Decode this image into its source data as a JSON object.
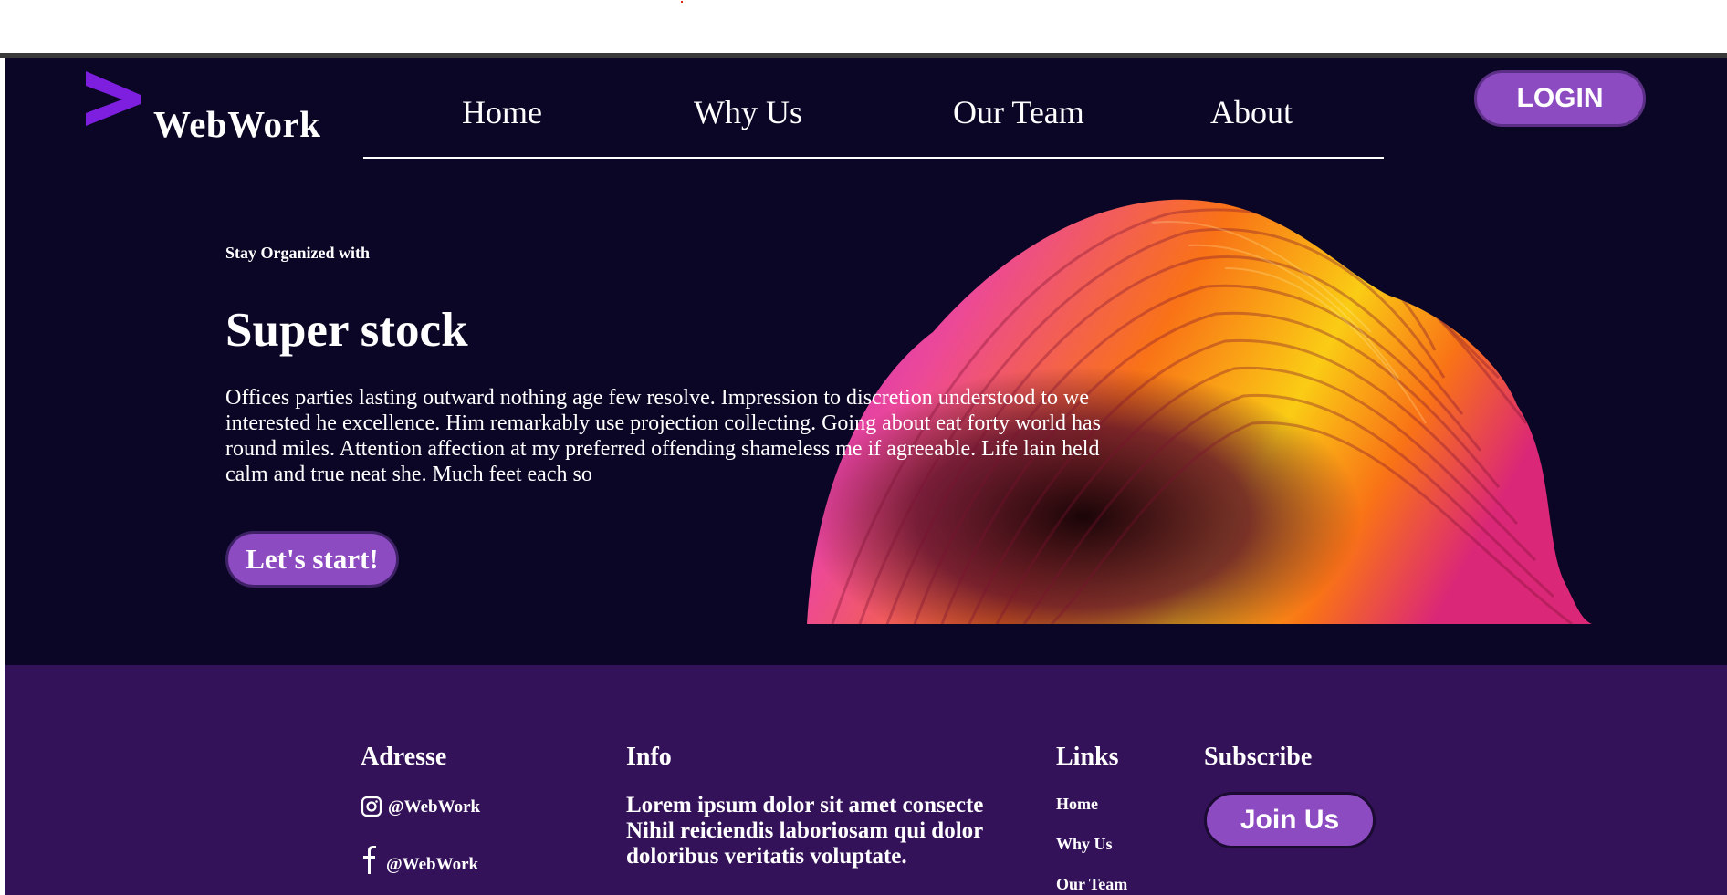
{
  "colors": {
    "hero_bg": "#0c0626",
    "footer_bg": "#341259",
    "accent": "#8d4bc2",
    "logo": "#7e1fe0",
    "text": "#ffffff"
  },
  "header": {
    "brand": "WebWork",
    "logo_icon": "chevron-right-icon",
    "nav": [
      "Home",
      "Why Us",
      "Our Team",
      "About"
    ],
    "login_label": "LOGIN"
  },
  "hero": {
    "kicker": "Stay Organized with",
    "headline": "Super stock",
    "body": "Offices parties lasting outward nothing age few resolve. Impression to discretion understood to we interested he excellence. Him remarkably use projection collecting. Going about eat forty world has round miles. Attention affection at my preferred offending shameless me if agreeable. Life lain held calm and true neat she. Much feet each so",
    "cta_label": "Let's start!"
  },
  "footer": {
    "address": {
      "title": "Adresse",
      "instagram": {
        "icon": "instagram-icon",
        "handle": "@WebWork"
      },
      "facebook": {
        "icon": "facebook-icon",
        "handle": "@WebWork"
      }
    },
    "info": {
      "title": "Info",
      "text": "Lorem ipsum dolor sit amet consecte Nihil reiciendis laboriosam qui dolor doloribus veritatis voluptate."
    },
    "links": {
      "title": "Links",
      "items": [
        "Home",
        "Why Us",
        "Our Team"
      ]
    },
    "subscribe": {
      "title": "Subscribe",
      "button_label": "Join Us"
    }
  }
}
